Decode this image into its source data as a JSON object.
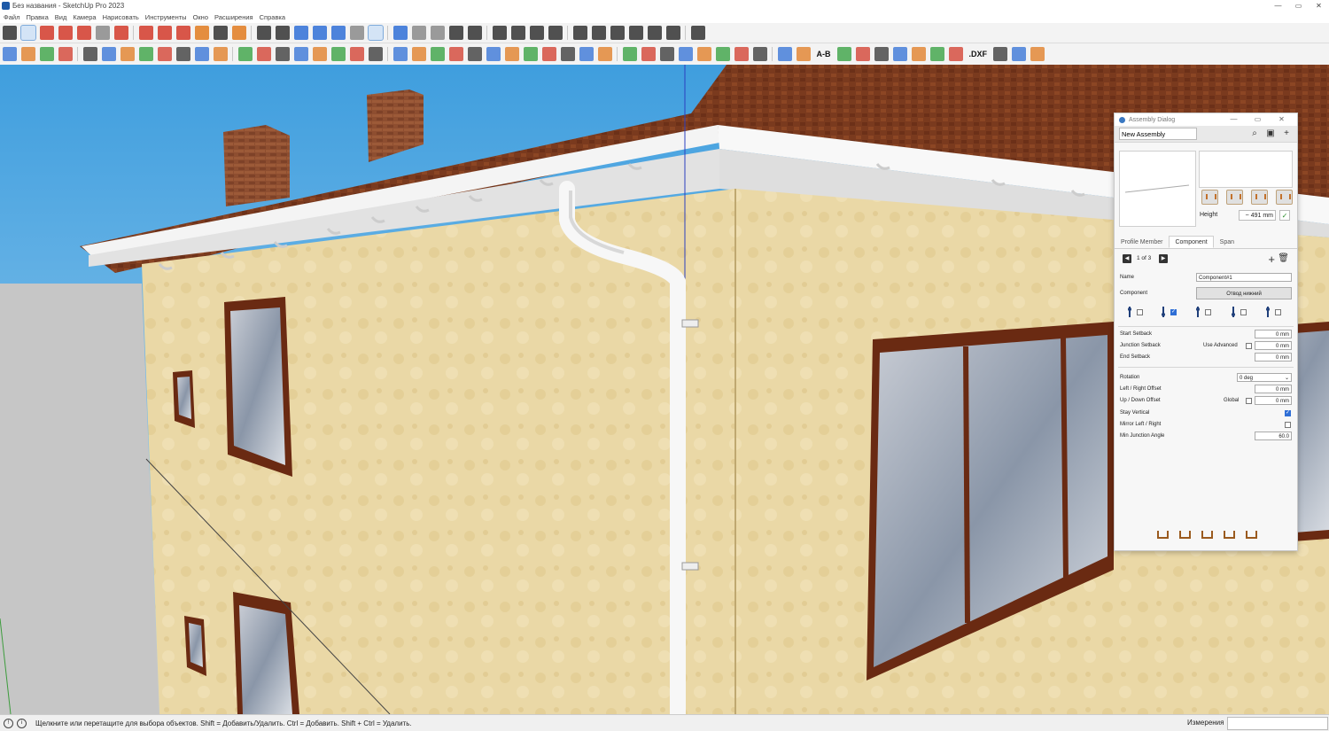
{
  "window": {
    "title": "Без названия - SketchUp Pro 2023",
    "controls": [
      "—",
      "▭",
      "✕"
    ]
  },
  "menu": [
    "Файл",
    "Правка",
    "Вид",
    "Камера",
    "Нарисовать",
    "Инструменты",
    "Окно",
    "Расширения",
    "Справка"
  ],
  "toolbar1": {
    "icons": [
      "search-icon",
      "select-arrow-icon",
      "eraser-icon",
      "line-icon",
      "arc-icon",
      "rectangle-icon",
      "pushpull-icon",
      "move-icon",
      "rotate-icon",
      "scale-icon",
      "offset-icon",
      "tape-measure-icon",
      "paint-icon",
      "zoom-icon",
      "zoom-extents-icon",
      "orbit-icon",
      "pan-icon",
      "walk-icon",
      "position-camera-icon",
      "section-icon",
      "shape-icon",
      "box-icon",
      "component-icon",
      "group-icon",
      "cube-icon",
      "warehouse-icon",
      "house-icon",
      "door-icon",
      "window-icon",
      "solid-outer-icon",
      "solid-union-icon",
      "solid-intersect-icon",
      "solid-subtract-icon",
      "solid-trim-icon",
      "solid-split-icon",
      "knife-icon"
    ],
    "colors": {
      "red": "#d23a2a",
      "blue": "#2f6fd6",
      "green": "#2f9e3a",
      "dark": "#333333",
      "orange": "#e07a1f",
      "gray": "#8a8a8a"
    }
  },
  "toolbar2": {
    "label_ab": "A-B",
    "label_dxf": ".DXF"
  },
  "status": {
    "hint": "Щелкните или перетащите для выбора объектов. Shift = Добавить/Удалить. Ctrl = Добавить. Shift + Ctrl = Удалить.",
    "measure_label": "Измерения",
    "measure_value": ""
  },
  "dialog": {
    "title": "Assembly Dialog",
    "assembly_name": "New Assembly",
    "height_label": "Height",
    "height_value": "~ 491 mm",
    "tabs": [
      "Profile Member",
      "Component",
      "Span"
    ],
    "active_tab": "Component",
    "pager": "1 of 3",
    "name_label": "Name",
    "name_value": "Component#1",
    "component_label": "Component",
    "component_value": "Отвод нижний",
    "connectors": [
      false,
      true,
      false,
      false,
      false
    ],
    "start_setback_label": "Start Setback",
    "start_setback": "0 mm",
    "junction_setback_label": "Junction Setback",
    "use_advanced_label": "Use Advanced",
    "use_advanced": false,
    "junction_setback": "0 mm",
    "end_setback_label": "End Setback",
    "end_setback": "0 mm",
    "rotation_label": "Rotation",
    "rotation_value": "0 deg",
    "lr_offset_label": "Left / Right Offset",
    "lr_offset": "0 mm",
    "ud_offset_label": "Up / Down Offset",
    "global_label": "Global",
    "global": false,
    "ud_offset": "0 mm",
    "stay_vertical_label": "Stay Vertical",
    "stay_vertical": true,
    "mirror_label": "Mirror Left / Right",
    "mirror": false,
    "min_angle_label": "Min Junction Angle",
    "min_angle": "60.0"
  },
  "scene": {
    "sky": "#4aa6e0",
    "wall": "#ead7a4",
    "roof": "#7a3a1e",
    "gutter": "#ffffff",
    "chimney": "#8a4a2e",
    "window_frame": "#6a2a12"
  }
}
